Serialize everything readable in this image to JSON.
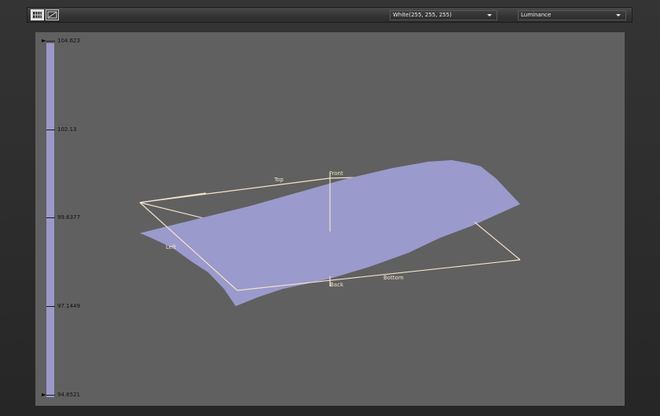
{
  "toolbar": {
    "grid_button_icon": "grid-icon",
    "chart_button_icon": "chart-icon",
    "color_select": {
      "value": "White(255, 255, 255)"
    },
    "channel_select": {
      "value": "Luminance"
    }
  },
  "scale": {
    "max": "104.623",
    "v2": "102.13",
    "v3": "99.6377",
    "v4": "97.1449",
    "min": "94.6521",
    "color": "#9a99c9"
  },
  "plot": {
    "surface_color": "#9b9acc",
    "frame_color": "#f4e3cc",
    "labels": {
      "top": "Top",
      "front": "Front",
      "left": "Left",
      "back": "Back",
      "bottom": "Bottom"
    }
  }
}
